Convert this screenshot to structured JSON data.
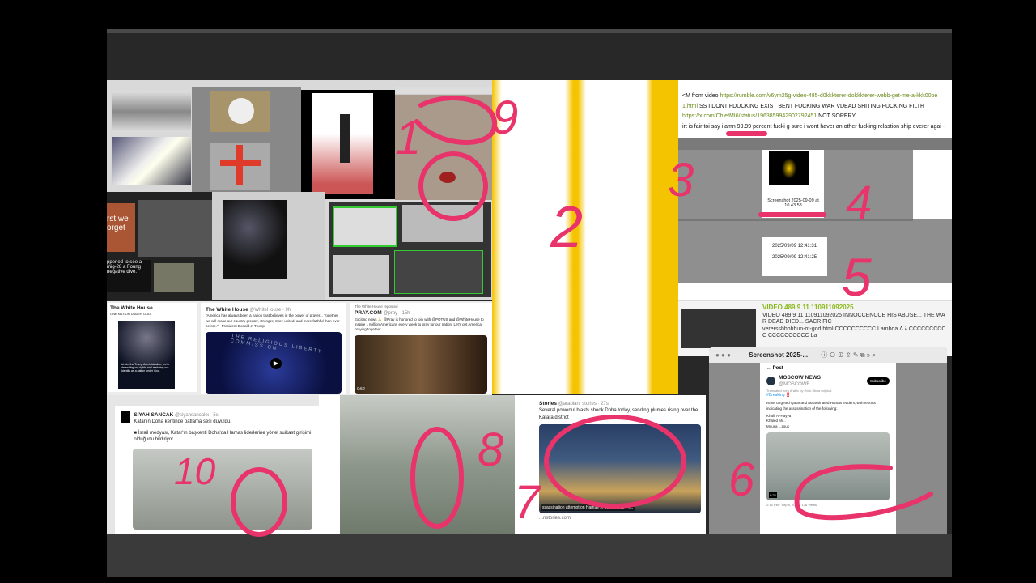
{
  "top_text": {
    "line1_prefix": "<M from video",
    "line1_link": "https://rumble.com/v6ym25g-video-485-d0kkkterer-dokkkterer-webb-get-me-a-kkk00pe",
    "line2_link": "1.html",
    "line2_text": "SS I DONT FDUCKING EXIST BENT FUCKING WAR VDEAD SHITING FUCKING FILTH",
    "line3_link": "https://x.com/ChiefMI6/status/1963859942902792451",
    "line3_text": "NOT SORERY",
    "line4_text": "irt is fair toi say i amn 99.99 percent fucki g sure i wont haver an other fucking relastion ship everer agai -"
  },
  "files": {
    "screenshot_name": "Screenshot 2025-09-09 at 10.43.58",
    "timestamps": [
      "2025/09/09 12:41:31",
      "2025/09/09 12:41:25"
    ]
  },
  "video_item": {
    "title": "VIDEO 489 9 11 110911092025",
    "desc1": "VIDEO 489 9 11 110911092025 INNOCCENCCE HIS ABUSE... THE WAR DEAD DIED... SACRIFIC",
    "desc2": "verersshhhhhun-of-god.html CCCCCCCCCC Lambda Λ λ CCCCCCCCCC CCCCCCCCCC La"
  },
  "preview_window": {
    "title": "Screenshot 2025-...",
    "post_header": "Post",
    "account": "MOSCOW NEWS",
    "handle": "@MOSCOWB",
    "subscribe": "Subscribe",
    "translated": "Translated from Arabic by Grok  Show original",
    "hashtag": "#Breaking ‼️",
    "body": "Israel targeted Qatar and assassinated Hamas leaders, with reports indicating the assassination of the following:",
    "names": [
      "Khalil Al-Hayya",
      "Khaled Mi...",
      "Mousa ...zouk"
    ],
    "video_time": "0:22",
    "footer": "2:14 PM · Sep 9, 2025 · 136 Views"
  },
  "tweets": {
    "wh1": {
      "name": "The White House",
      "sub": "ONE NATION UNDER GOD",
      "quote": "Under the Trump Administration, we're defending our rights and restoring our identity as a nation under God."
    },
    "wh2": {
      "name": "The White House",
      "handle": "@WhiteHouse · 9h",
      "body": "\"America has always been a nation that believes in the power of prayer... Together we will make our country greater, stronger, more united, and more faithful than ever before.\" - President Donald J. Trump",
      "video_text": "THE RELIGIOUS LIBERTY COMMISSION"
    },
    "pray": {
      "repost": "The White House reposted",
      "name": "PRAY.COM",
      "handle": "@pray · 15h",
      "body": "Exciting news 🙏 @Pray is honored to join with @POTUS and @WhiteHouse to inspire 1 Million Americans every week to pray for our nation. Let's get America praying together.",
      "time": "0:52"
    },
    "siyah": {
      "name": "SİYAH SANCAK",
      "handle": "@siyahsancakx · 5s",
      "line1": "Katar'ın Doha kentinde patlama sesi duyuldu.",
      "line2": "■ İsrail medyası, Katar'ın başkenti Doha'da Hamas liderlerine yönel suikast girişimi olduğunu bildiriyor."
    },
    "arabian": {
      "name": "Stories",
      "handle": "@arabian_stories · 27s",
      "body": "Several powerful blasts shook Doha today, sending plumes rising over the Katara district",
      "caption": "ssassination attempt on Hamas ... ports Axios - T...",
      "domain": "...nstories.com"
    }
  },
  "collage": {
    "poster_text": "rst we orget",
    "mig_text": "ppened to see a mig-28 a Foung negative dive."
  },
  "annotations": [
    "1",
    "9",
    "2",
    "3",
    "4",
    "5",
    "6",
    "7",
    "8",
    "10"
  ],
  "colors": {
    "annotation": "#e8336b",
    "yellow": "#f5c400",
    "link": "#6a8a1a",
    "title_green": "#8ab81a"
  }
}
